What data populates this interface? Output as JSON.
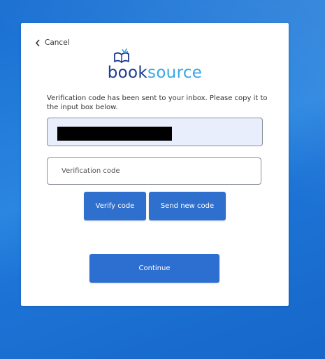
{
  "colors": {
    "background": "#1d74d6",
    "card": "#ffffff",
    "button": "#2f6fcd",
    "logo_dark": "#1d3c8f",
    "logo_light": "#3aa6e4",
    "email_field_bg": "#e8eefb"
  },
  "header": {
    "cancel_label": "Cancel",
    "cancel_icon": "chevron-left-icon"
  },
  "logo": {
    "icon": "open-book-icon",
    "text_part1": "book",
    "text_part2": "source"
  },
  "message": "Verification code has been sent to your inbox. Please copy it to the input box below.",
  "email_field": {
    "value": "",
    "redacted": true
  },
  "code_field": {
    "placeholder": "Verification code",
    "value": ""
  },
  "buttons": {
    "verify": "Verify code",
    "send_new": "Send new code",
    "continue": "Continue"
  }
}
